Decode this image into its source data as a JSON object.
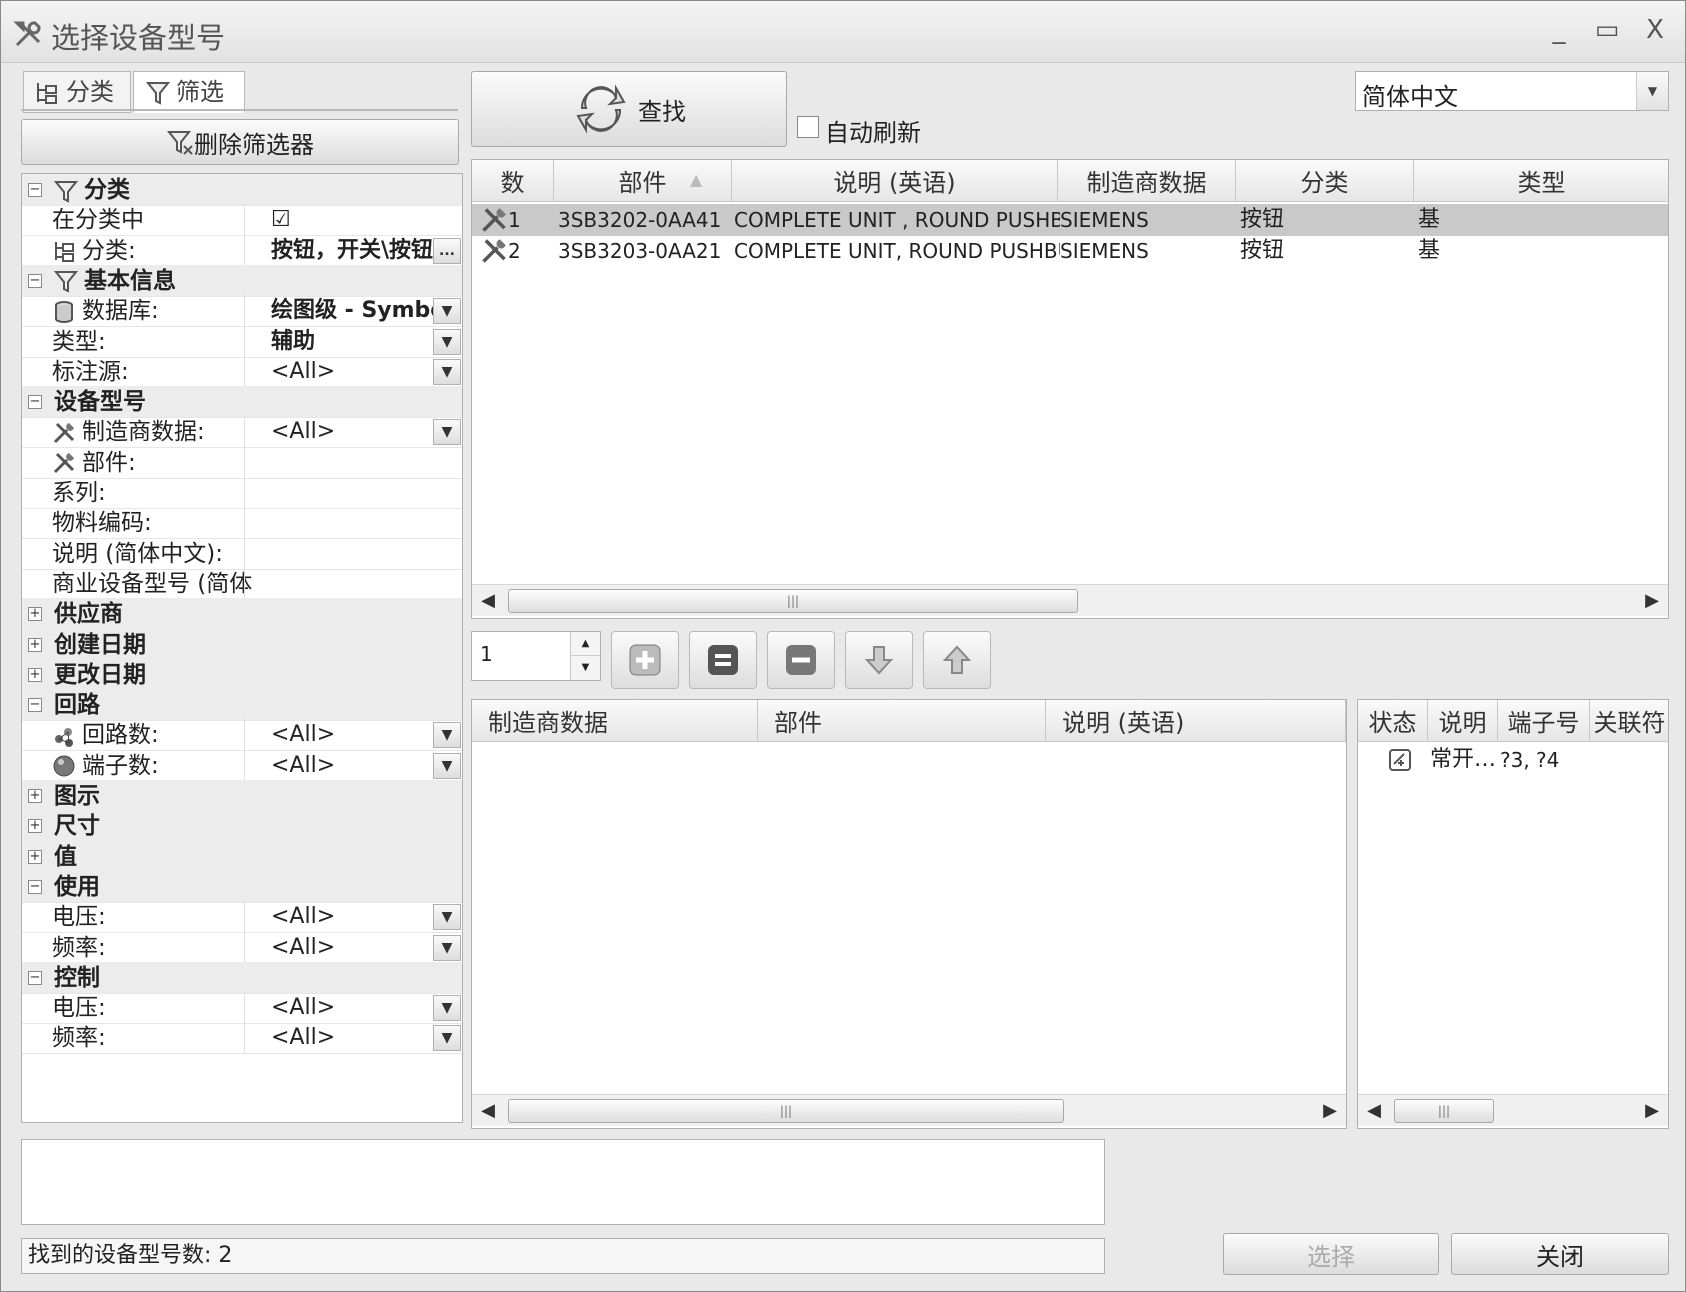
{
  "window": {
    "title": "选择设备型号",
    "minimize": "_",
    "maximize": "▭",
    "close": "X"
  },
  "tabs": [
    {
      "label": "分类"
    },
    {
      "label": "筛选"
    }
  ],
  "delete_filter_button": "删除筛选器",
  "find_button": "查找",
  "auto_refresh": {
    "label": "自动刷新",
    "checked": false
  },
  "language_select": {
    "value": "简体中文"
  },
  "filter": {
    "rows": [
      {
        "type": "group",
        "label": "分类",
        "expanded": true,
        "icon": "funnel-icon"
      },
      {
        "type": "field",
        "label": "在分类中",
        "value": "☑"
      },
      {
        "type": "field",
        "label": "分类:",
        "value": "按钮，开关\\按钮",
        "bold": true,
        "icon": "tree-icon",
        "button": "..."
      },
      {
        "type": "group",
        "label": "基本信息",
        "expanded": true,
        "icon": "funnel-icon"
      },
      {
        "type": "field",
        "label": "数据库:",
        "value": "绘图级 - Symbol",
        "bold": true,
        "icon": "database-icon",
        "dropdown": true
      },
      {
        "type": "field",
        "label": "类型:",
        "value": "辅助",
        "bold": true,
        "dropdown": true
      },
      {
        "type": "field",
        "label": "标注源:",
        "value": "<All>",
        "dropdown": true
      },
      {
        "type": "group",
        "label": "设备型号",
        "expanded": true
      },
      {
        "type": "field",
        "label": "制造商数据:",
        "value": "<All>",
        "icon": "tools-icon",
        "dropdown": true
      },
      {
        "type": "field",
        "label": "部件:",
        "value": "",
        "icon": "tools-icon"
      },
      {
        "type": "field",
        "label": "系列:",
        "value": ""
      },
      {
        "type": "field",
        "label": "物料编码:",
        "value": ""
      },
      {
        "type": "field",
        "label": "说明 (简体中文):",
        "value": ""
      },
      {
        "type": "field",
        "label": "商业设备型号 (简体",
        "value": ""
      },
      {
        "type": "group",
        "label": "供应商",
        "expanded": false
      },
      {
        "type": "group",
        "label": "创建日期",
        "expanded": false
      },
      {
        "type": "group",
        "label": "更改日期",
        "expanded": false
      },
      {
        "type": "group",
        "label": "回路",
        "expanded": true
      },
      {
        "type": "field",
        "label": "回路数:",
        "value": "<All>",
        "icon": "circuit-icon",
        "dropdown": true
      },
      {
        "type": "field",
        "label": "端子数:",
        "value": "<All>",
        "icon": "ball-icon",
        "dropdown": true
      },
      {
        "type": "group",
        "label": "图示",
        "expanded": false
      },
      {
        "type": "group",
        "label": "尺寸",
        "expanded": false
      },
      {
        "type": "group",
        "label": "值",
        "expanded": false
      },
      {
        "type": "group",
        "label": "使用",
        "expanded": true
      },
      {
        "type": "field",
        "label": "电压:",
        "value": "<All>",
        "dropdown": true
      },
      {
        "type": "field",
        "label": "频率:",
        "value": "<All>",
        "dropdown": true
      },
      {
        "type": "group",
        "label": "控制",
        "expanded": true
      },
      {
        "type": "field",
        "label": "电压:",
        "value": "<All>",
        "dropdown": true
      },
      {
        "type": "field",
        "label": "频率:",
        "value": "<All>",
        "dropdown": true
      }
    ]
  },
  "results": {
    "columns": [
      "数",
      "部件",
      "说明 (英语)",
      "制造商数据",
      "分类",
      "类型"
    ],
    "rows": [
      {
        "num": "1",
        "part": "3SB3202-0AA41",
        "desc": "COMPLETE UNIT , ROUND PUSHBU…",
        "maker": "SIEMENS",
        "cat": "按钮",
        "type": "基",
        "selected": true
      },
      {
        "num": "2",
        "part": "3SB3203-0AA21",
        "desc": "COMPLETE UNIT, ROUND PUSHBUT…",
        "maker": "SIEMENS",
        "cat": "按钮",
        "type": "基",
        "selected": false
      }
    ]
  },
  "quantity": "1",
  "details": {
    "columns": [
      "制造商数据",
      "部件",
      "说明 (英语)"
    ]
  },
  "functions": {
    "columns": [
      "状态",
      "说明",
      "端子号",
      "关联符"
    ],
    "rows": [
      {
        "desc": "常开…",
        "terminals": "?3, ?4"
      }
    ]
  },
  "status_text": "找到的设备型号数: 2",
  "select_button": "选择",
  "close_button": "关闭"
}
